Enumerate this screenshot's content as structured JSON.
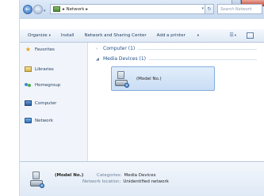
{
  "window": {
    "title": ""
  },
  "address_bar": {
    "path": "▸ Network ▸",
    "dropdown": "▾",
    "refresh": "↻"
  },
  "search": {
    "placeholder": "Search Network"
  },
  "navigation": {
    "back": "←",
    "forward": "→",
    "recent": "▾"
  },
  "toolbar": {
    "items": [
      {
        "label": "Organize",
        "has_menu": true
      },
      {
        "label": "Install",
        "has_menu": false
      },
      {
        "label": "Network and Sharing Center",
        "has_menu": false
      },
      {
        "label": "Add a printer",
        "has_menu": false
      },
      {
        "label": "",
        "has_menu": true
      }
    ],
    "views_glyph": "☰",
    "menu_arrow": "▾"
  },
  "sidebar": {
    "items": [
      {
        "label": "Favorites",
        "icon": "star-icon"
      },
      {
        "label": "Libraries",
        "icon": "library-icon"
      },
      {
        "label": "Homegroup",
        "icon": "homegroup-icon"
      },
      {
        "label": "Computer",
        "icon": "computer-icon"
      },
      {
        "label": "Network",
        "icon": "network-icon",
        "selected": true
      }
    ],
    "star_glyph": "★"
  },
  "content": {
    "groups": [
      {
        "label": "Computer (1)",
        "collapsed": true,
        "chevron": "›"
      },
      {
        "label": "Media Devices (1)",
        "collapsed": false,
        "chevron": "◢"
      }
    ],
    "device_tile": {
      "label": "(Model No.)",
      "icon": "media-device-icon",
      "selected": true
    }
  },
  "details_pane": {
    "name": "(Model No.)",
    "rows": [
      {
        "key": "Categories:",
        "value": "Media Devices"
      },
      {
        "key": "Network location:",
        "value": "Unidentified network"
      }
    ]
  },
  "colors": {
    "toolbar_bg": "#dfe9f5",
    "selection_fill": "#c9ddf4",
    "selection_border": "#84acdd",
    "link_text": "#1e4f8a"
  }
}
